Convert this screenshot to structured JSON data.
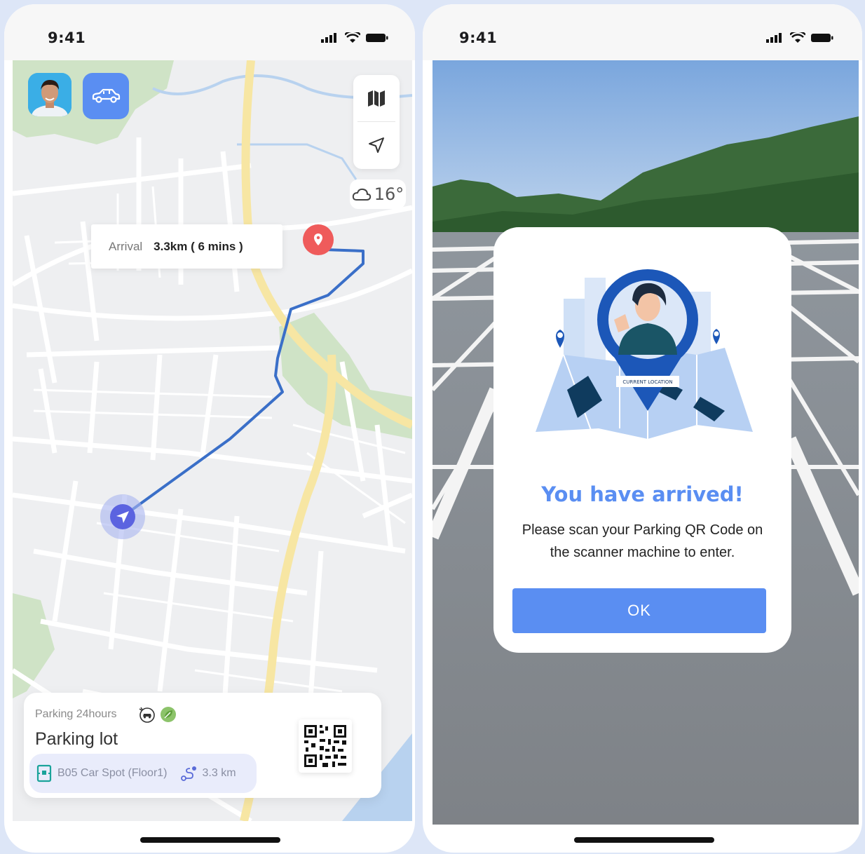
{
  "left_screen": {
    "status": {
      "time": "9:41"
    },
    "map": {
      "arrival_label": "Arrival",
      "arrival_value": "3.3km ( 6 mins )",
      "weather_temp": "16°"
    },
    "parking_card": {
      "type": "Parking 24hours",
      "title": "Parking lot",
      "spot": "B05 Car Spot (Floor1)",
      "distance": "3.3 km"
    },
    "icons": [
      "avatar",
      "car-icon",
      "map-icon",
      "navigate-icon",
      "cloud-icon",
      "location-pin-icon",
      "car-badge-icon",
      "leaf-badge-icon",
      "parking-spot-icon",
      "route-icon",
      "qr-code"
    ]
  },
  "right_screen": {
    "status": {
      "time": "9:41"
    },
    "modal": {
      "illustration_label": "CURRENT LOCATION",
      "title": "You have arrived!",
      "message_line1": "Please scan your Parking QR Code on",
      "message_line2": "the scanner machine to enter.",
      "ok_label": "OK"
    }
  },
  "colors": {
    "accent": "#5a8ef2",
    "route": "#3a6fc8",
    "pin": "#ef5b5b",
    "background": "#dde6f7"
  }
}
